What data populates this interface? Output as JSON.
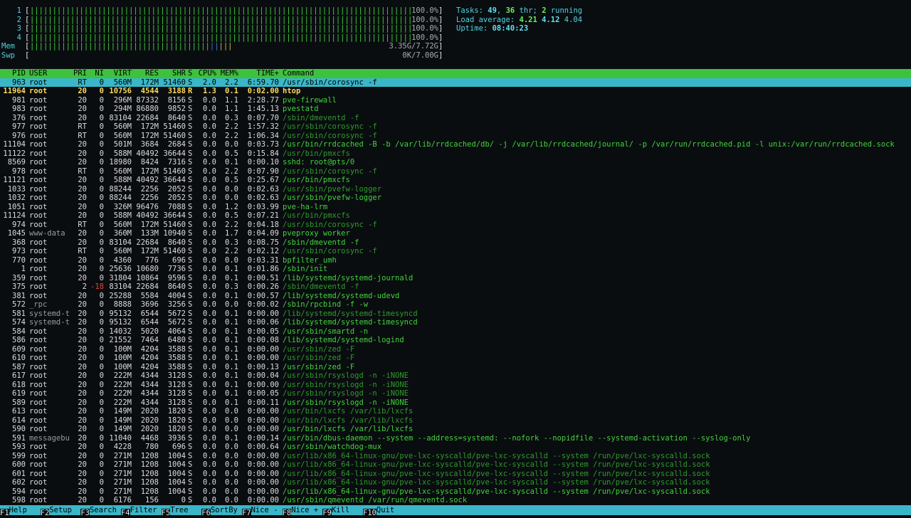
{
  "meters": {
    "cpus": [
      {
        "label": "1",
        "value": "100.0%"
      },
      {
        "label": "2",
        "value": "100.0%"
      },
      {
        "label": "3",
        "value": "100.0%"
      },
      {
        "label": "4",
        "value": "100.0%"
      }
    ],
    "mem": {
      "label": "Mem",
      "value": "3.35G/7.72G",
      "fraction": 0.434
    },
    "swp": {
      "label": "Swp",
      "value": "0K/7.00G",
      "fraction": 0.0
    }
  },
  "summary": {
    "tasks_label": "Tasks:",
    "tasks": "49",
    "threads": "36",
    "threads_suffix": "thr;",
    "running": "2",
    "running_suffix": "running",
    "load_label": "Load average:",
    "load1": "4.21",
    "load5": "4.12",
    "load15": "4.04",
    "uptime_label": "Uptime:",
    "uptime": "08:40:23"
  },
  "columns": [
    "PID",
    "USER",
    "PRI",
    "NI",
    "VIRT",
    "RES",
    "SHR",
    "S",
    "CPU%",
    "MEM%",
    "TIME+",
    "Command"
  ],
  "processes": [
    {
      "pid": "963",
      "user": "root",
      "pri": "RT",
      "ni": "0",
      "virt": "560M",
      "res": "172M",
      "shr": "51460",
      "s": "S",
      "cpu": "2.0",
      "mem": "2.2",
      "time": "6:59.70",
      "cmd": "/usr/sbin/corosync -f",
      "style": "selected"
    },
    {
      "pid": "11964",
      "user": "root",
      "pri": "20",
      "ni": "0",
      "virt": "10756",
      "res": "4544",
      "shr": "3188",
      "s": "R",
      "cpu": "1.3",
      "mem": "0.1",
      "time": "0:02.00",
      "cmd": "htop",
      "style": "highlight"
    },
    {
      "pid": "981",
      "user": "root",
      "pri": "20",
      "ni": "0",
      "virt": "296M",
      "res": "87332",
      "shr": "8156",
      "s": "S",
      "cpu": "0.0",
      "mem": "1.1",
      "time": "2:28.77",
      "cmd": "pve-firewall",
      "style": "proc"
    },
    {
      "pid": "983",
      "user": "root",
      "pri": "20",
      "ni": "0",
      "virt": "294M",
      "res": "86880",
      "shr": "9852",
      "s": "S",
      "cpu": "0.0",
      "mem": "1.1",
      "time": "1:45.13",
      "cmd": "pvestatd",
      "style": "proc"
    },
    {
      "pid": "376",
      "user": "root",
      "pri": "20",
      "ni": "0",
      "virt": "83104",
      "res": "22684",
      "shr": "8640",
      "s": "S",
      "cpu": "0.0",
      "mem": "0.3",
      "time": "0:07.70",
      "cmd": "/sbin/dmeventd -f",
      "style": "thread"
    },
    {
      "pid": "977",
      "user": "root",
      "pri": "RT",
      "ni": "0",
      "virt": "560M",
      "res": "172M",
      "shr": "51460",
      "s": "S",
      "cpu": "0.0",
      "mem": "2.2",
      "time": "1:57.32",
      "cmd": "/usr/sbin/corosync -f",
      "style": "thread"
    },
    {
      "pid": "976",
      "user": "root",
      "pri": "RT",
      "ni": "0",
      "virt": "560M",
      "res": "172M",
      "shr": "51460",
      "s": "S",
      "cpu": "0.0",
      "mem": "2.2",
      "time": "1:06.34",
      "cmd": "/usr/sbin/corosync -f",
      "style": "thread"
    },
    {
      "pid": "11104",
      "user": "root",
      "pri": "20",
      "ni": "0",
      "virt": "501M",
      "res": "3684",
      "shr": "2684",
      "s": "S",
      "cpu": "0.0",
      "mem": "0.0",
      "time": "0:03.73",
      "cmd": "/usr/bin/rrdcached -B -b /var/lib/rrdcached/db/ -j /var/lib/rrdcached/journal/ -p /var/run/rrdcached.pid -l unix:/var/run/rrdcached.sock",
      "style": "proc"
    },
    {
      "pid": "11122",
      "user": "root",
      "pri": "20",
      "ni": "0",
      "virt": "588M",
      "res": "40492",
      "shr": "36644",
      "s": "S",
      "cpu": "0.0",
      "mem": "0.5",
      "time": "0:15.84",
      "cmd": "/usr/bin/pmxcfs",
      "style": "thread"
    },
    {
      "pid": "8569",
      "user": "root",
      "pri": "20",
      "ni": "0",
      "virt": "18980",
      "res": "8424",
      "shr": "7316",
      "s": "S",
      "cpu": "0.0",
      "mem": "0.1",
      "time": "0:00.10",
      "cmd": "sshd: root@pts/0",
      "style": "proc"
    },
    {
      "pid": "978",
      "user": "root",
      "pri": "RT",
      "ni": "0",
      "virt": "560M",
      "res": "172M",
      "shr": "51460",
      "s": "S",
      "cpu": "0.0",
      "mem": "2.2",
      "time": "0:07.90",
      "cmd": "/usr/sbin/corosync -f",
      "style": "thread"
    },
    {
      "pid": "11121",
      "user": "root",
      "pri": "20",
      "ni": "0",
      "virt": "588M",
      "res": "40492",
      "shr": "36644",
      "s": "S",
      "cpu": "0.0",
      "mem": "0.5",
      "time": "0:25.67",
      "cmd": "/usr/bin/pmxcfs",
      "style": "proc"
    },
    {
      "pid": "1033",
      "user": "root",
      "pri": "20",
      "ni": "0",
      "virt": "88244",
      "res": "2256",
      "shr": "2052",
      "s": "S",
      "cpu": "0.0",
      "mem": "0.0",
      "time": "0:02.63",
      "cmd": "/usr/sbin/pvefw-logger",
      "style": "thread"
    },
    {
      "pid": "1032",
      "user": "root",
      "pri": "20",
      "ni": "0",
      "virt": "88244",
      "res": "2256",
      "shr": "2052",
      "s": "S",
      "cpu": "0.0",
      "mem": "0.0",
      "time": "0:02.63",
      "cmd": "/usr/sbin/pvefw-logger",
      "style": "proc"
    },
    {
      "pid": "1051",
      "user": "root",
      "pri": "20",
      "ni": "0",
      "virt": "326M",
      "res": "96476",
      "shr": "7088",
      "s": "S",
      "cpu": "0.0",
      "mem": "1.2",
      "time": "0:03.99",
      "cmd": "pve-ha-lrm",
      "style": "proc"
    },
    {
      "pid": "11124",
      "user": "root",
      "pri": "20",
      "ni": "0",
      "virt": "588M",
      "res": "40492",
      "shr": "36644",
      "s": "S",
      "cpu": "0.0",
      "mem": "0.5",
      "time": "0:07.21",
      "cmd": "/usr/bin/pmxcfs",
      "style": "thread"
    },
    {
      "pid": "974",
      "user": "root",
      "pri": "RT",
      "ni": "0",
      "virt": "560M",
      "res": "172M",
      "shr": "51460",
      "s": "S",
      "cpu": "0.0",
      "mem": "2.2",
      "time": "0:04.18",
      "cmd": "/usr/sbin/corosync -f",
      "style": "thread"
    },
    {
      "pid": "1045",
      "user": "www-data",
      "pri": "20",
      "ni": "0",
      "virt": "360M",
      "res": "133M",
      "shr": "10940",
      "s": "S",
      "cpu": "0.0",
      "mem": "1.7",
      "time": "0:04.09",
      "cmd": "pveproxy worker",
      "style": "proc"
    },
    {
      "pid": "368",
      "user": "root",
      "pri": "20",
      "ni": "0",
      "virt": "83104",
      "res": "22684",
      "shr": "8640",
      "s": "S",
      "cpu": "0.0",
      "mem": "0.3",
      "time": "0:08.75",
      "cmd": "/sbin/dmeventd -f",
      "style": "proc"
    },
    {
      "pid": "973",
      "user": "root",
      "pri": "RT",
      "ni": "0",
      "virt": "560M",
      "res": "172M",
      "shr": "51460",
      "s": "S",
      "cpu": "0.0",
      "mem": "2.2",
      "time": "0:02.12",
      "cmd": "/usr/sbin/corosync -f",
      "style": "thread"
    },
    {
      "pid": "770",
      "user": "root",
      "pri": "20",
      "ni": "0",
      "virt": "4360",
      "res": "776",
      "shr": "696",
      "s": "S",
      "cpu": "0.0",
      "mem": "0.0",
      "time": "0:03.31",
      "cmd": "bpfilter_umh",
      "style": "proc"
    },
    {
      "pid": "1",
      "user": "root",
      "pri": "20",
      "ni": "0",
      "virt": "25636",
      "res": "10680",
      "shr": "7736",
      "s": "S",
      "cpu": "0.0",
      "mem": "0.1",
      "time": "0:01.86",
      "cmd": "/sbin/init",
      "style": "proc"
    },
    {
      "pid": "359",
      "user": "root",
      "pri": "20",
      "ni": "0",
      "virt": "31804",
      "res": "10864",
      "shr": "9596",
      "s": "S",
      "cpu": "0.0",
      "mem": "0.1",
      "time": "0:00.51",
      "cmd": "/lib/systemd/systemd-journald",
      "style": "proc"
    },
    {
      "pid": "375",
      "user": "root",
      "pri": "2",
      "ni": "-18",
      "virt": "83104",
      "res": "22684",
      "shr": "8640",
      "s": "S",
      "cpu": "0.0",
      "mem": "0.3",
      "time": "0:00.26",
      "cmd": "/sbin/dmeventd -f",
      "style": "thread"
    },
    {
      "pid": "381",
      "user": "root",
      "pri": "20",
      "ni": "0",
      "virt": "25288",
      "res": "5584",
      "shr": "4004",
      "s": "S",
      "cpu": "0.0",
      "mem": "0.1",
      "time": "0:00.57",
      "cmd": "/lib/systemd/systemd-udevd",
      "style": "proc"
    },
    {
      "pid": "572",
      "user": "_rpc",
      "pri": "20",
      "ni": "0",
      "virt": "8888",
      "res": "3696",
      "shr": "3256",
      "s": "S",
      "cpu": "0.0",
      "mem": "0.0",
      "time": "0:00.02",
      "cmd": "/sbin/rpcbind -f -w",
      "style": "proc"
    },
    {
      "pid": "581",
      "user": "systemd-t",
      "pri": "20",
      "ni": "0",
      "virt": "95132",
      "res": "6544",
      "shr": "5672",
      "s": "S",
      "cpu": "0.0",
      "mem": "0.1",
      "time": "0:00.00",
      "cmd": "/lib/systemd/systemd-timesyncd",
      "style": "thread"
    },
    {
      "pid": "574",
      "user": "systemd-t",
      "pri": "20",
      "ni": "0",
      "virt": "95132",
      "res": "6544",
      "shr": "5672",
      "s": "S",
      "cpu": "0.0",
      "mem": "0.1",
      "time": "0:00.06",
      "cmd": "/lib/systemd/systemd-timesyncd",
      "style": "proc"
    },
    {
      "pid": "584",
      "user": "root",
      "pri": "20",
      "ni": "0",
      "virt": "14032",
      "res": "5020",
      "shr": "4064",
      "s": "S",
      "cpu": "0.0",
      "mem": "0.1",
      "time": "0:00.05",
      "cmd": "/usr/sbin/smartd -n",
      "style": "proc"
    },
    {
      "pid": "586",
      "user": "root",
      "pri": "20",
      "ni": "0",
      "virt": "21552",
      "res": "7464",
      "shr": "6480",
      "s": "S",
      "cpu": "0.0",
      "mem": "0.1",
      "time": "0:00.08",
      "cmd": "/lib/systemd/systemd-logind",
      "style": "proc"
    },
    {
      "pid": "609",
      "user": "root",
      "pri": "20",
      "ni": "0",
      "virt": "100M",
      "res": "4204",
      "shr": "3588",
      "s": "S",
      "cpu": "0.0",
      "mem": "0.1",
      "time": "0:00.00",
      "cmd": "/usr/sbin/zed -F",
      "style": "thread"
    },
    {
      "pid": "610",
      "user": "root",
      "pri": "20",
      "ni": "0",
      "virt": "100M",
      "res": "4204",
      "shr": "3588",
      "s": "S",
      "cpu": "0.0",
      "mem": "0.1",
      "time": "0:00.00",
      "cmd": "/usr/sbin/zed -F",
      "style": "thread"
    },
    {
      "pid": "587",
      "user": "root",
      "pri": "20",
      "ni": "0",
      "virt": "100M",
      "res": "4204",
      "shr": "3588",
      "s": "S",
      "cpu": "0.0",
      "mem": "0.1",
      "time": "0:00.13",
      "cmd": "/usr/sbin/zed -F",
      "style": "proc"
    },
    {
      "pid": "617",
      "user": "root",
      "pri": "20",
      "ni": "0",
      "virt": "222M",
      "res": "4344",
      "shr": "3128",
      "s": "S",
      "cpu": "0.0",
      "mem": "0.1",
      "time": "0:00.04",
      "cmd": "/usr/sbin/rsyslogd -n -iNONE",
      "style": "thread"
    },
    {
      "pid": "618",
      "user": "root",
      "pri": "20",
      "ni": "0",
      "virt": "222M",
      "res": "4344",
      "shr": "3128",
      "s": "S",
      "cpu": "0.0",
      "mem": "0.1",
      "time": "0:00.00",
      "cmd": "/usr/sbin/rsyslogd -n -iNONE",
      "style": "thread"
    },
    {
      "pid": "619",
      "user": "root",
      "pri": "20",
      "ni": "0",
      "virt": "222M",
      "res": "4344",
      "shr": "3128",
      "s": "S",
      "cpu": "0.0",
      "mem": "0.1",
      "time": "0:00.05",
      "cmd": "/usr/sbin/rsyslogd -n -iNONE",
      "style": "thread"
    },
    {
      "pid": "589",
      "user": "root",
      "pri": "20",
      "ni": "0",
      "virt": "222M",
      "res": "4344",
      "shr": "3128",
      "s": "S",
      "cpu": "0.0",
      "mem": "0.1",
      "time": "0:00.11",
      "cmd": "/usr/sbin/rsyslogd -n -iNONE",
      "style": "proc"
    },
    {
      "pid": "613",
      "user": "root",
      "pri": "20",
      "ni": "0",
      "virt": "149M",
      "res": "2020",
      "shr": "1820",
      "s": "S",
      "cpu": "0.0",
      "mem": "0.0",
      "time": "0:00.00",
      "cmd": "/usr/bin/lxcfs /var/lib/lxcfs",
      "style": "thread"
    },
    {
      "pid": "614",
      "user": "root",
      "pri": "20",
      "ni": "0",
      "virt": "149M",
      "res": "2020",
      "shr": "1820",
      "s": "S",
      "cpu": "0.0",
      "mem": "0.0",
      "time": "0:00.00",
      "cmd": "/usr/bin/lxcfs /var/lib/lxcfs",
      "style": "thread"
    },
    {
      "pid": "590",
      "user": "root",
      "pri": "20",
      "ni": "0",
      "virt": "149M",
      "res": "2020",
      "shr": "1820",
      "s": "S",
      "cpu": "0.0",
      "mem": "0.0",
      "time": "0:00.00",
      "cmd": "/usr/bin/lxcfs /var/lib/lxcfs",
      "style": "proc"
    },
    {
      "pid": "591",
      "user": "messagebu",
      "pri": "20",
      "ni": "0",
      "virt": "11040",
      "res": "4468",
      "shr": "3936",
      "s": "S",
      "cpu": "0.0",
      "mem": "0.1",
      "time": "0:00.14",
      "cmd": "/usr/bin/dbus-daemon --system --address=systemd: --nofork --nopidfile --systemd-activation --syslog-only",
      "style": "proc"
    },
    {
      "pid": "593",
      "user": "root",
      "pri": "20",
      "ni": "0",
      "virt": "4228",
      "res": "780",
      "shr": "696",
      "s": "S",
      "cpu": "0.0",
      "mem": "0.0",
      "time": "0:00.64",
      "cmd": "/usr/sbin/watchdog-mux",
      "style": "proc"
    },
    {
      "pid": "599",
      "user": "root",
      "pri": "20",
      "ni": "0",
      "virt": "271M",
      "res": "1208",
      "shr": "1004",
      "s": "S",
      "cpu": "0.0",
      "mem": "0.0",
      "time": "0:00.00",
      "cmd": "/usr/lib/x86_64-linux-gnu/pve-lxc-syscalld/pve-lxc-syscalld --system /run/pve/lxc-syscalld.sock",
      "style": "thread"
    },
    {
      "pid": "600",
      "user": "root",
      "pri": "20",
      "ni": "0",
      "virt": "271M",
      "res": "1208",
      "shr": "1004",
      "s": "S",
      "cpu": "0.0",
      "mem": "0.0",
      "time": "0:00.00",
      "cmd": "/usr/lib/x86_64-linux-gnu/pve-lxc-syscalld/pve-lxc-syscalld --system /run/pve/lxc-syscalld.sock",
      "style": "thread"
    },
    {
      "pid": "601",
      "user": "root",
      "pri": "20",
      "ni": "0",
      "virt": "271M",
      "res": "1208",
      "shr": "1004",
      "s": "S",
      "cpu": "0.0",
      "mem": "0.0",
      "time": "0:00.00",
      "cmd": "/usr/lib/x86_64-linux-gnu/pve-lxc-syscalld/pve-lxc-syscalld --system /run/pve/lxc-syscalld.sock",
      "style": "thread"
    },
    {
      "pid": "602",
      "user": "root",
      "pri": "20",
      "ni": "0",
      "virt": "271M",
      "res": "1208",
      "shr": "1004",
      "s": "S",
      "cpu": "0.0",
      "mem": "0.0",
      "time": "0:00.00",
      "cmd": "/usr/lib/x86_64-linux-gnu/pve-lxc-syscalld/pve-lxc-syscalld --system /run/pve/lxc-syscalld.sock",
      "style": "thread"
    },
    {
      "pid": "594",
      "user": "root",
      "pri": "20",
      "ni": "0",
      "virt": "271M",
      "res": "1208",
      "shr": "1004",
      "s": "S",
      "cpu": "0.0",
      "mem": "0.0",
      "time": "0:00.00",
      "cmd": "/usr/lib/x86_64-linux-gnu/pve-lxc-syscalld/pve-lxc-syscalld --system /run/pve/lxc-syscalld.sock",
      "style": "proc"
    },
    {
      "pid": "598",
      "user": "root",
      "pri": "20",
      "ni": "0",
      "virt": "6176",
      "res": "156",
      "shr": "0",
      "s": "S",
      "cpu": "0.0",
      "mem": "0.0",
      "time": "0:00.00",
      "cmd": "/usr/sbin/qmeventd /var/run/qmeventd.sock",
      "style": "proc"
    }
  ],
  "function_keys": [
    {
      "key": "F1",
      "label": "Help"
    },
    {
      "key": "F2",
      "label": "Setup"
    },
    {
      "key": "F3",
      "label": "Search"
    },
    {
      "key": "F4",
      "label": "Filter"
    },
    {
      "key": "F5",
      "label": "Tree"
    },
    {
      "key": "F6",
      "label": "SortBy"
    },
    {
      "key": "F7",
      "label": "Nice -"
    },
    {
      "key": "F8",
      "label": "Nice +"
    },
    {
      "key": "F9",
      "label": "Kill"
    },
    {
      "key": "F10",
      "label": "Quit"
    }
  ],
  "colors": {
    "background": "#0a0d10",
    "header_bg": "#3fc13d",
    "selected_bg": "#3ab6c9",
    "proc_green": "#41d33b",
    "thread_dim": "#2e9a2b",
    "meter_cyan": "#4fd3e0",
    "highlight_yellow": "#ffd85a"
  }
}
